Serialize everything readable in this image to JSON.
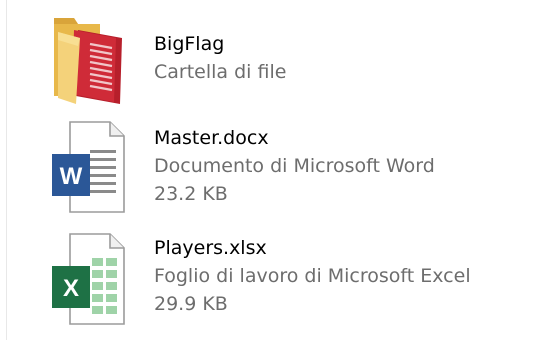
{
  "files": [
    {
      "name": "BigFlag",
      "type": "Cartella di file",
      "icon": "folder-icon",
      "size": ""
    },
    {
      "name": "Master.docx",
      "type": "Documento di Microsoft Word",
      "size": "23.2 KB",
      "icon": "word-document-icon",
      "badge": "W",
      "accent": "#2b5797"
    },
    {
      "name": "Players.xlsx",
      "type": "Foglio di lavoro di Microsoft Excel",
      "size": "29.9 KB",
      "icon": "excel-spreadsheet-icon",
      "badge": "X",
      "accent": "#1e7145"
    }
  ]
}
